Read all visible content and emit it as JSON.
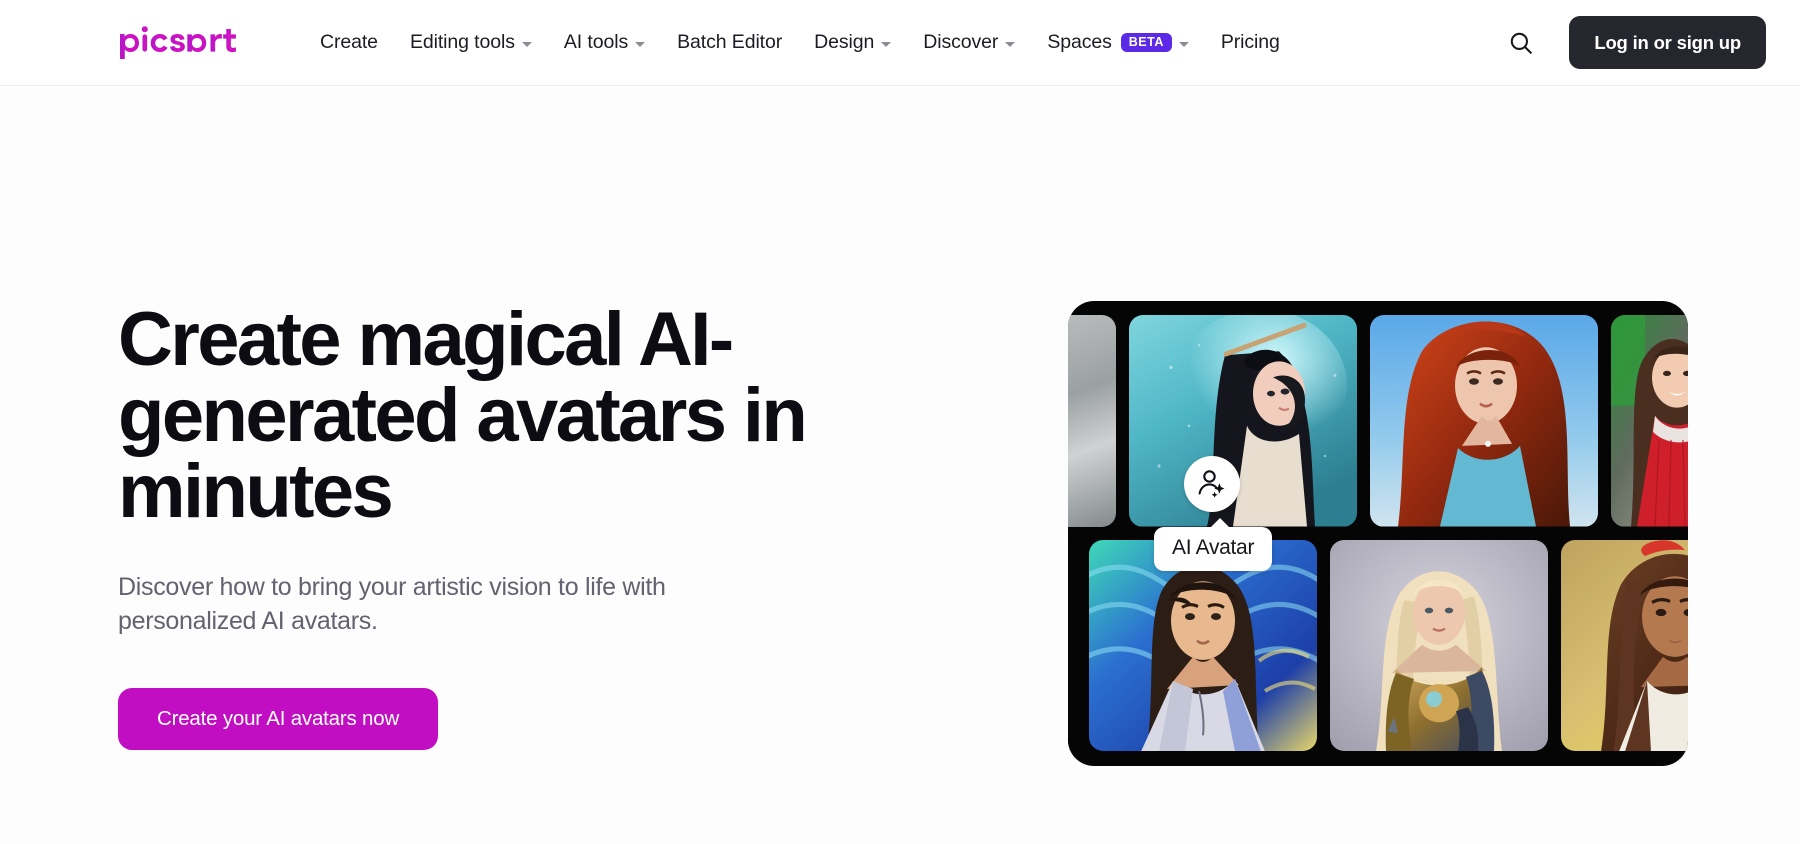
{
  "brand": {
    "name": "Picsart",
    "logo_colors": [
      "#b216c8",
      "#d413c4",
      "#c40fbe"
    ]
  },
  "header": {
    "nav": [
      {
        "label": "Create",
        "has_dropdown": false,
        "badge": null
      },
      {
        "label": "Editing tools",
        "has_dropdown": true,
        "badge": null
      },
      {
        "label": "AI tools",
        "has_dropdown": true,
        "badge": null
      },
      {
        "label": "Batch Editor",
        "has_dropdown": false,
        "badge": null
      },
      {
        "label": "Design",
        "has_dropdown": true,
        "badge": null
      },
      {
        "label": "Discover",
        "has_dropdown": true,
        "badge": null
      },
      {
        "label": "Spaces",
        "has_dropdown": true,
        "badge": "BETA"
      },
      {
        "label": "Pricing",
        "has_dropdown": false,
        "badge": null
      }
    ],
    "search_icon": "search-icon",
    "login_label": "Log in or sign up",
    "login_bg": "#26262e",
    "beta_badge_bg": "#5c29e6"
  },
  "hero": {
    "title": "Create magical AI-generated avatars in minutes",
    "subtitle": "Discover how to bring your artistic vision to life with personalized AI avatars.",
    "cta_label": "Create your AI avatars now",
    "cta_bg": "#c20ec2",
    "badge_label": "AI Avatar",
    "badge_icon": "person-sparkle-icon",
    "frame_bg": "#050505",
    "tiles": [
      {
        "id": "tile-0",
        "row": 1,
        "position": "partial-left",
        "alt": "pale figure in white, partially cropped"
      },
      {
        "id": "tile-1",
        "row": 1,
        "position": "main",
        "alt": "anime woman with long black hair and hairpin on teal background"
      },
      {
        "id": "tile-2",
        "row": 1,
        "position": "main",
        "alt": "red-haired woman painted portrait on blue sky background"
      },
      {
        "id": "tile-3",
        "row": 1,
        "position": "partial-right",
        "alt": "smiling woman in red sequin dress, photo"
      },
      {
        "id": "tile-4",
        "row": 2,
        "position": "main",
        "alt": "young man in hoodie, swirling van-gogh style blue background"
      },
      {
        "id": "tile-5",
        "row": 2,
        "position": "mid",
        "alt": "blonde woman in golden armor, grey background"
      },
      {
        "id": "tile-6",
        "row": 2,
        "position": "main",
        "alt": "woman with wavy brown hair, golden yellow background"
      }
    ]
  },
  "page": {
    "background": "#fdfdfd"
  }
}
